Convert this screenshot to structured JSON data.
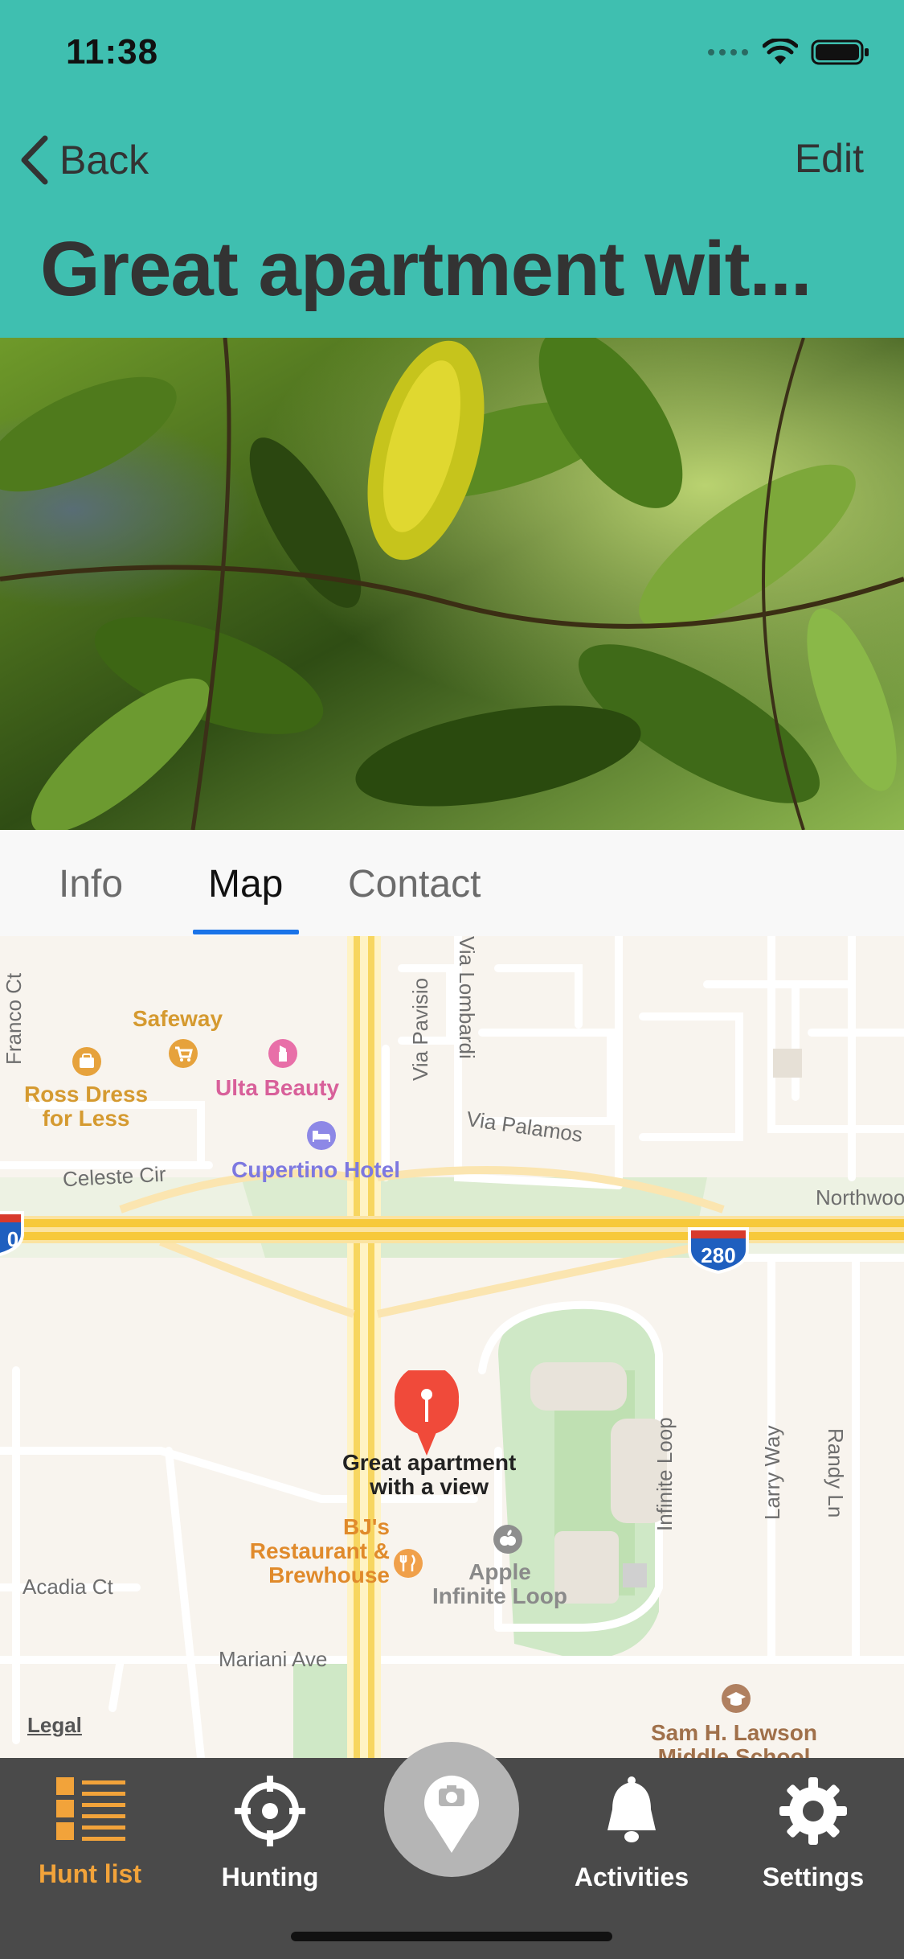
{
  "status_bar": {
    "time": "11:38"
  },
  "nav": {
    "back_label": "Back",
    "edit_label": "Edit",
    "title": "Great apartment wit..."
  },
  "tabs": [
    {
      "label": "Info",
      "active": false
    },
    {
      "label": "Map",
      "active": true
    },
    {
      "label": "Contact",
      "active": false
    }
  ],
  "map": {
    "streets": [
      "Franco Ct",
      "Via Pavisio",
      "Via Lombardi",
      "Via Palamos",
      "Celeste Cir",
      "Northwood",
      "Infinite Loop",
      "Larry Way",
      "Randy Ln",
      "Acadia Ct",
      "Mariani Ave"
    ],
    "highway_shield": "280",
    "highway_shield_left": "0",
    "pois": {
      "safeway": "Safeway",
      "ross": "Ross Dress\nfor Less",
      "ulta": "Ulta Beauty",
      "hotel": "Cupertino Hotel",
      "bjs": "BJ's\nRestaurant &\nBrewhouse",
      "apple": "Apple\nInfinite Loop",
      "school": "Sam H. Lawson\nMiddle School"
    },
    "pin_label": "Great apartment\nwith a view",
    "legal": "Legal",
    "colors": {
      "food": "#e08a2b",
      "shopping": "#e6a23c",
      "beauty": "#d8609a",
      "hotel": "#7d78e0",
      "school": "#a0704a",
      "pin": "#f04a3a"
    }
  },
  "tabbar": {
    "items": [
      {
        "label": "Hunt list",
        "icon": "list-icon",
        "active": true
      },
      {
        "label": "Hunting",
        "icon": "crosshair-icon",
        "active": false
      },
      {
        "label": "",
        "icon": "camera-pin-icon",
        "active": false
      },
      {
        "label": "Activities",
        "icon": "bell-icon",
        "active": false
      },
      {
        "label": "Settings",
        "icon": "gear-icon",
        "active": false
      }
    ],
    "colors": {
      "background": "#4a4a4a",
      "active": "#f2a33a"
    }
  },
  "header_color": "#3fbfb0"
}
